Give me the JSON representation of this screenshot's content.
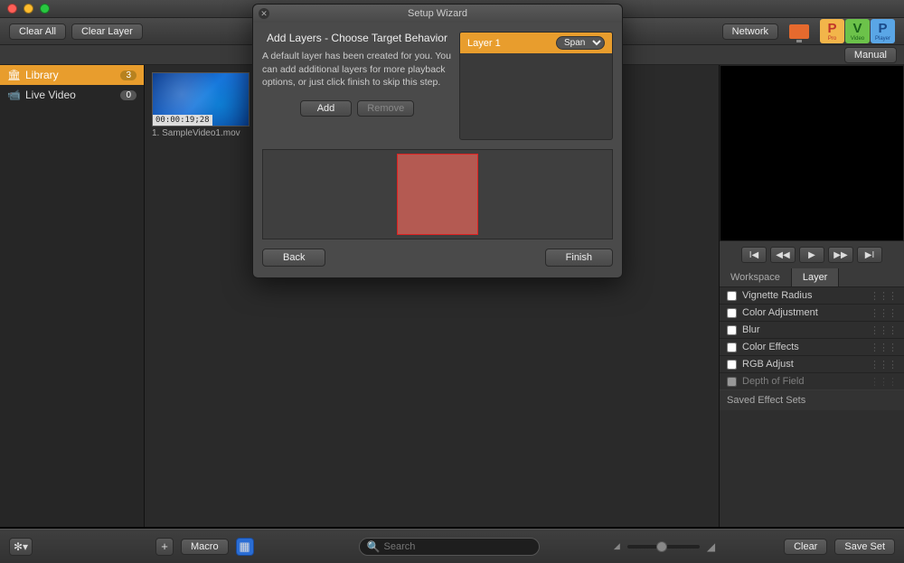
{
  "toolbar": {
    "clear_all": "Clear All",
    "clear_layer": "Clear Layer",
    "network": "Network",
    "manual": "Manual"
  },
  "brand": {
    "pro": "Pro",
    "video": "Video",
    "player": "Player"
  },
  "sidebar": {
    "items": [
      {
        "label": "Library",
        "count": "3"
      },
      {
        "label": "Live Video",
        "count": "0"
      }
    ]
  },
  "thumbs": [
    {
      "timecode": "00:00:19;28",
      "label": "1. SampleVideo1.mov"
    }
  ],
  "inspector": {
    "tabs": {
      "workspace": "Workspace",
      "layer": "Layer"
    },
    "effects": [
      "Vignette Radius",
      "Color Adjustment",
      "Blur",
      "Color Effects",
      "RGB Adjust",
      "Depth of Field"
    ],
    "saved_sets": "Saved Effect Sets"
  },
  "bottom": {
    "macro": "Macro",
    "search_placeholder": "Search",
    "clear": "Clear",
    "save_set": "Save Set"
  },
  "wizard": {
    "title": "Setup Wizard",
    "heading": "Add Layers - Choose Target Behavior",
    "description": "A default layer has been created for you. You can add additional layers for more playback options, or just click finish to skip this step.",
    "add": "Add",
    "remove": "Remove",
    "back": "Back",
    "finish": "Finish",
    "layers": [
      {
        "name": "Layer 1",
        "mode": "Span"
      }
    ]
  }
}
